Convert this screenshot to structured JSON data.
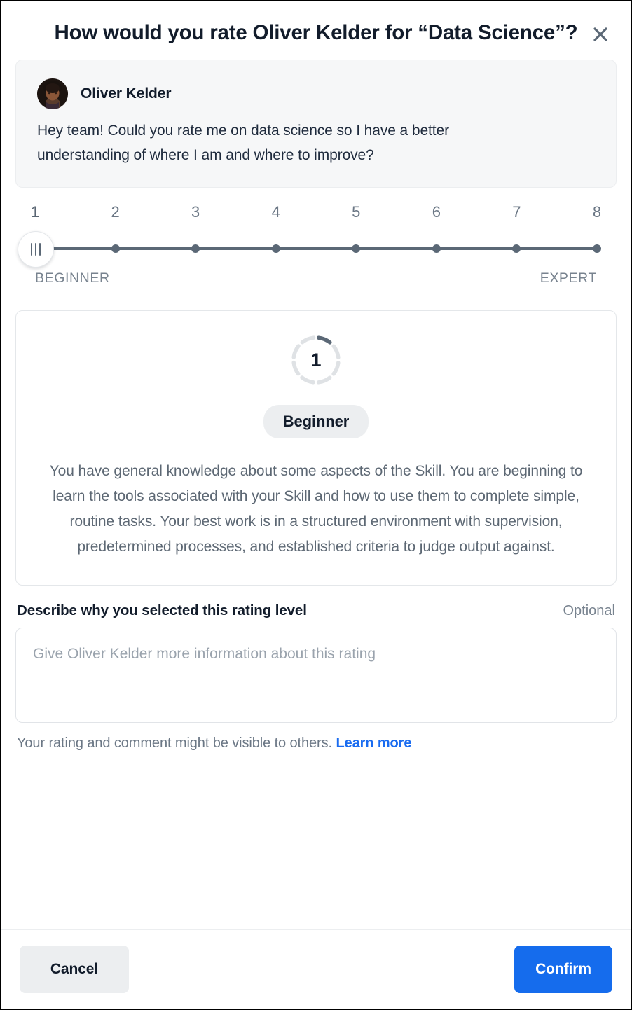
{
  "dialog": {
    "title": "How would you rate Oliver Kelder for “Data Science”?",
    "close_icon": "close-icon"
  },
  "request": {
    "author": "Oliver Kelder",
    "message": "Hey team! Could you rate me on data science so I have a better understanding of where I am and where to improve?",
    "avatar_alt": "Oliver Kelder avatar"
  },
  "slider": {
    "ticks": [
      "1",
      "2",
      "3",
      "4",
      "5",
      "6",
      "7",
      "8"
    ],
    "value": 1,
    "min": 1,
    "max": 8,
    "low_label": "BEGINNER",
    "high_label": "EXPERT"
  },
  "level": {
    "number": "1",
    "name": "Beginner",
    "description": "You have general knowledge about some aspects of the Skill. You are beginning to learn the tools associated with your Skill and how to use them to complete simple, routine tasks. Your best work is in a structured environment with supervision, predetermined processes, and established criteria to judge output against.",
    "ring_segments_total": 8,
    "ring_segments_filled": 1,
    "ring_filled_color": "#5b6876",
    "ring_empty_color": "#dfe2e5"
  },
  "comment": {
    "label": "Describe why you selected this rating level",
    "optional_tag": "Optional",
    "placeholder": "Give Oliver Kelder more information about this rating",
    "value": ""
  },
  "disclaimer": {
    "text": "Your rating and comment might be visible to others.",
    "link_label": "Learn more",
    "link_color": "#1a6cf0"
  },
  "footer": {
    "cancel_label": "Cancel",
    "confirm_label": "Confirm",
    "confirm_color": "#156ced"
  }
}
